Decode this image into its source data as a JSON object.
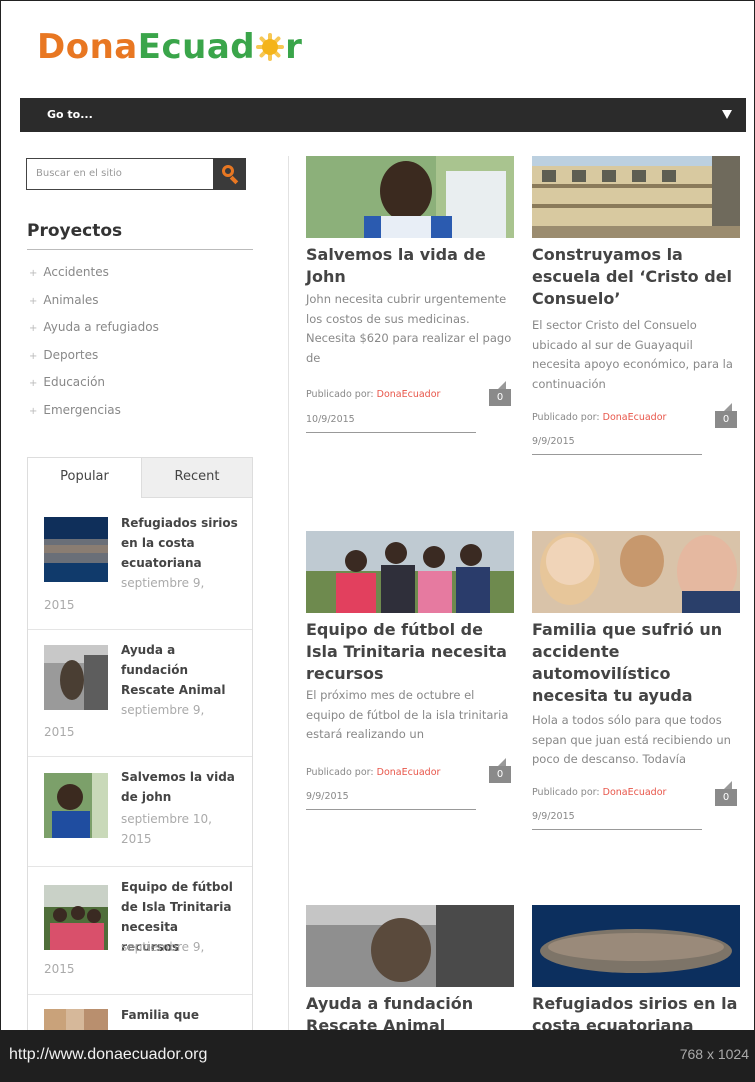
{
  "logo": {
    "part1": "Dona",
    "part2": "Ecuad",
    "part3": "r"
  },
  "nav": {
    "goto_label": "Go to..."
  },
  "sidebar": {
    "search_placeholder": "Buscar en el sitio",
    "projects_title": "Proyectos",
    "categories": [
      "Accidentes",
      "Animales",
      "Ayuda a refugiados",
      "Deportes",
      "Educación",
      "Emergencias"
    ],
    "tabs": {
      "popular": "Popular",
      "recent": "Recent"
    },
    "popular_items": [
      {
        "title": "Refugiados sirios en la costa ecuatoriana",
        "date_a": "septiembre 9,",
        "date_b": "2015"
      },
      {
        "title": "Ayuda a fundación Rescate Animal",
        "date_a": "septiembre 9,",
        "date_b": "2015"
      },
      {
        "title": "Salvemos la vida de john",
        "date_a": "septiembre 10,",
        "date_b": "2015"
      },
      {
        "title": "Equipo de fútbol de Isla Trinitaria necesita recursos",
        "date_a": "septiembre 9,",
        "date_b": "2015"
      },
      {
        "title": "Familia que",
        "date_a": "",
        "date_b": ""
      }
    ]
  },
  "posts": [
    {
      "title": "Salvemos la vida de John",
      "excerpt": "John necesita cubrir urgentemente los costos de sus medicinas. Necesita $620 para realizar el pago de",
      "by_label": "Publicado por:",
      "author": "DonaEcuador",
      "date": "10/9/2015",
      "comments": "0"
    },
    {
      "title": "Construyamos la escuela del ‘Cristo del Consuelo’",
      "excerpt": "El sector Cristo del Consuelo ubicado al sur de Guayaquil necesita apoyo económico, para la continuación",
      "by_label": "Publicado por:",
      "author": "DonaEcuador",
      "date": "9/9/2015",
      "comments": "0"
    },
    {
      "title": "Equipo de fútbol de Isla Trinitaria necesita recursos",
      "excerpt": "El próximo mes de octubre el equipo de fútbol de la isla trinitaria estará realizando un",
      "by_label": "Publicado por:",
      "author": "DonaEcuador",
      "date": "9/9/2015",
      "comments": "0"
    },
    {
      "title": "Familia que sufrió un accidente automovilístico necesita tu ayuda",
      "excerpt": "Hola a todos sólo para que todos sepan que juan está recibiendo un poco de descanso. Todavía",
      "by_label": "Publicado por:",
      "author": "DonaEcuador",
      "date": "9/9/2015",
      "comments": "0"
    },
    {
      "title": "Ayuda a fundación Rescate Animal"
    },
    {
      "title": "Refugiados sirios en la costa ecuatoriana"
    }
  ],
  "statusbar": {
    "url": "http://www.donaecuador.org",
    "dims": "768 x 1024"
  },
  "colors": {
    "logo_orange": "#e87722",
    "logo_green": "#3aa54a",
    "author_red": "#e8564a",
    "nav_bg": "#2b2b2b"
  }
}
